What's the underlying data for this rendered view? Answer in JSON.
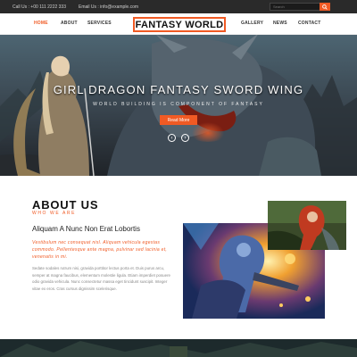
{
  "topbar": {
    "call": "Call Us : +00 111 2222 333",
    "email": "Email Us : info@example.com",
    "search_placeholder": "Search"
  },
  "nav": {
    "left": [
      "HOME",
      "ABOUT",
      "SERVICES"
    ],
    "right": [
      "GALLERY",
      "NEWS",
      "CONTACT"
    ],
    "logo": "FANTASY WORLD",
    "accent": "#f05a24"
  },
  "hero": {
    "title": "GIRL DRAGON FANTASY SWORD WING",
    "subtitle": "WORLD BUILDING IS COMPONENT OF FANTASY",
    "button": "Read More"
  },
  "about": {
    "title": "ABOUT US",
    "subtitle": "WHO WE ARE",
    "heading": "Aliquam A Nunc Non Erat Lobortis",
    "highlight": "Vestibulum nec consequat nisl. Aliquam vehicula egestas commodo. Pellentesque ante magna, pulvinar sed lacinia et, venenatis in mi.",
    "body": "Sedate sodales rutrum nisi, gravida porttitor lectus porta et. Duis purus arcu, semper at magna faucibus, elementum molestie ligula. Etiam imperdiet posuere odio gravida vehicula. Nunc consectetur massa eget tincidunt suscipit. Integer vitae ex eros. Cras cursus dignissim scelerisque."
  },
  "icons": {
    "search": "search-icon",
    "prev": "chevron-left-icon",
    "next": "chevron-right-icon"
  }
}
